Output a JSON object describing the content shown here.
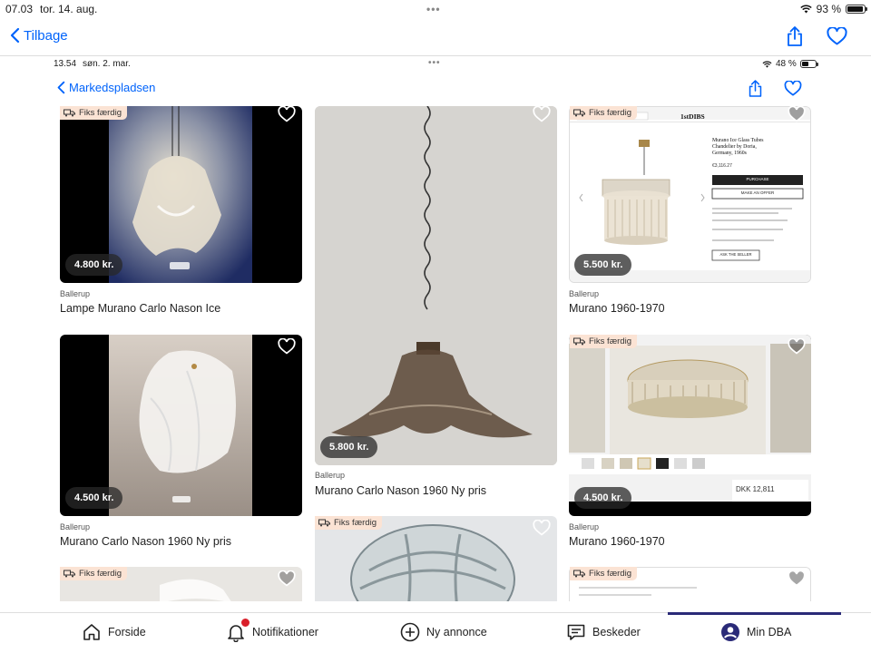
{
  "status": {
    "time": "07.03",
    "date": "tor. 14. aug.",
    "battery": "93 %",
    "battery_level": 0.93
  },
  "outer_nav": {
    "back_label": "Tilbage"
  },
  "inner_status": {
    "time": "13.54",
    "date": "søn. 2. mar.",
    "battery": "48 %",
    "battery_level": 0.48
  },
  "inner_nav": {
    "back_label": "Markedspladsen"
  },
  "listings": [
    {
      "location": "Ballerup",
      "title": "Lampe Murano Carlo Nason Ice",
      "price": "4.800 kr.",
      "badge": "Fiks færdig"
    },
    {
      "location": "Ballerup",
      "title": "Murano Carlo Nason 1960 Ny pris",
      "price": "5.800 kr."
    },
    {
      "location": "Ballerup",
      "title": "Murano 1960-1970",
      "price": "5.500 kr.",
      "badge": "Fiks færdig"
    },
    {
      "location": "Ballerup",
      "title": "Murano Carlo Nason 1960 Ny pris",
      "price": "4.500 kr."
    },
    {
      "location": "Ballerup",
      "title": "Murano 1960-1970",
      "price": "4.500 kr.",
      "badge": "Fiks færdig"
    },
    {
      "badge": "Fiks færdig"
    },
    {
      "badge": "Fiks færdig"
    },
    {
      "badge": "Fiks færdig"
    }
  ],
  "screenshot_text": {
    "site_logo": "1stDIBS",
    "product_title": "Murano Ice Glass Tubes Chandelier by Doria, Germany, 1960s",
    "product_price": "€3,116.27",
    "purchase_button": "PURCHASE",
    "offer_button": "MAKE AN OFFER",
    "ask_button": "ASK THE SELLER",
    "dkk_price": "DKK 12,811"
  },
  "tabs": [
    {
      "label": "Forside",
      "icon": "home-icon"
    },
    {
      "label": "Notifikationer",
      "icon": "bell-icon"
    },
    {
      "label": "Ny annonce",
      "icon": "plus-circle-icon"
    },
    {
      "label": "Beskeder",
      "icon": "chat-icon"
    },
    {
      "label": "Min DBA",
      "icon": "user-icon",
      "active": true
    }
  ],
  "colors": {
    "accent": "#0063fb",
    "badge_bg": "#fbe3d4",
    "active_tab": "#2a2a78",
    "notification_dot": "#d91f2a"
  }
}
